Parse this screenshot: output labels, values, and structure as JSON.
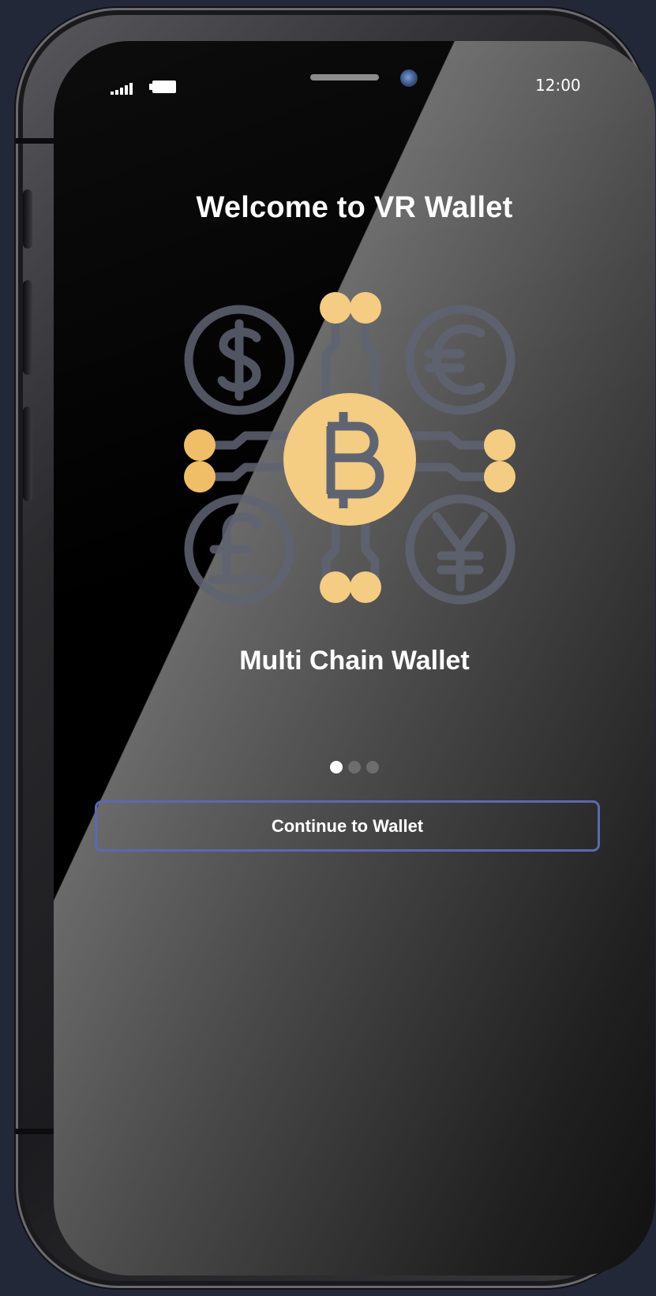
{
  "status_bar": {
    "time": "12:00",
    "signal_icon": "cellular-signal-icon",
    "battery_icon": "battery-icon"
  },
  "onboarding": {
    "title": "Welcome to VR Wallet",
    "subtitle": "Multi Chain Wallet",
    "illustration_icon": "crypto-network-icon",
    "currency_icons": [
      "dollar-coin-icon",
      "euro-coin-icon",
      "pound-coin-icon",
      "yen-coin-icon"
    ],
    "center_icon": "bitcoin-coin-icon",
    "page_count": 3,
    "active_page": 1
  },
  "cta": {
    "label": "Continue to Wallet"
  },
  "colors": {
    "accent_border": "#5b68b4",
    "coin_gold": "#f4cc82",
    "circuit_gray": "#5f6472",
    "dot_active": "#ffffff",
    "dot_inactive": "#6d6d6d"
  }
}
